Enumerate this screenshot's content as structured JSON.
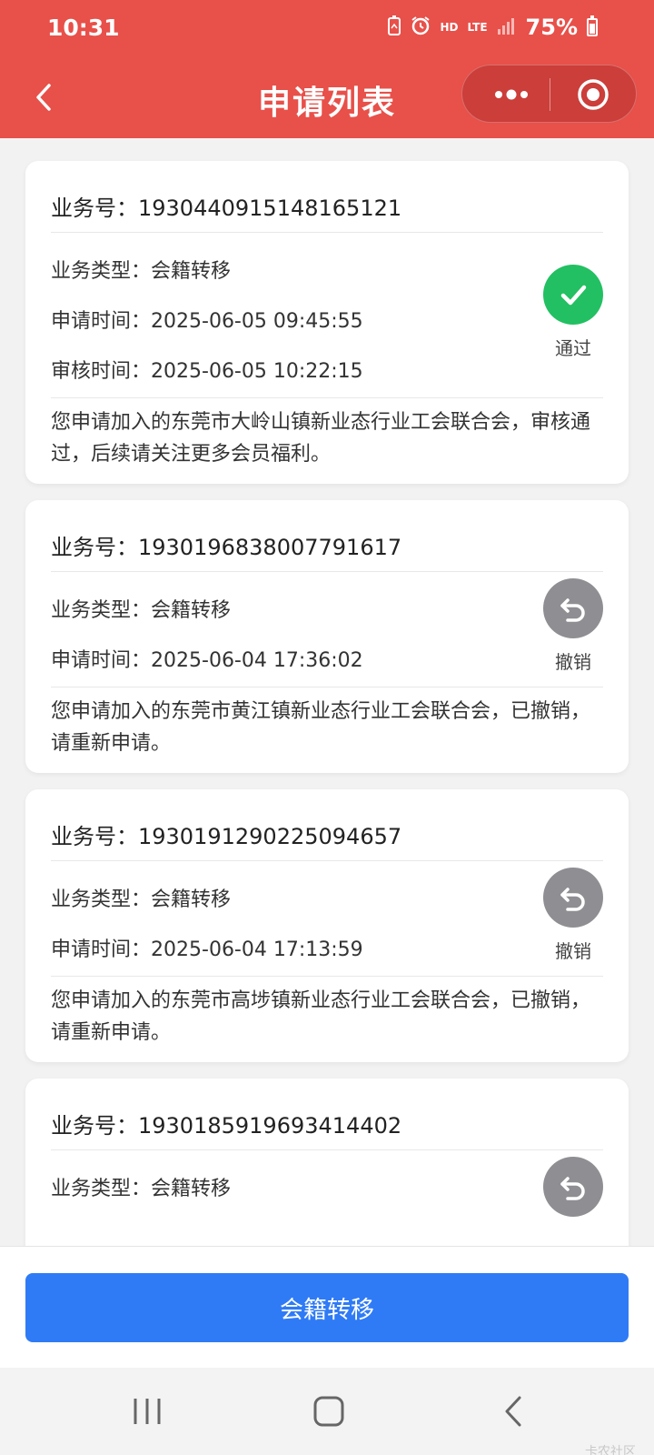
{
  "status_bar": {
    "time": "10:31",
    "network": "HD",
    "lte": "LTE",
    "battery": "75%"
  },
  "header": {
    "title": "申请列表"
  },
  "colors": {
    "header_bg": "#e8504a",
    "approved": "#22c062",
    "revoked": "#8e8e93",
    "primary": "#2f7bf6"
  },
  "applications": [
    {
      "no_label": "业务号：",
      "no": "1930440915148165121",
      "type_label": "业务类型：",
      "type": "会籍转移",
      "apply_label": "申请时间：",
      "apply_time": "2025-06-05 09:45:55",
      "review_label": "审核时间：",
      "review_time": "2025-06-05 10:22:15",
      "message": "您申请加入的东莞市大岭山镇新业态行业工会联合会，审核通过，后续请关注更多会员福利。",
      "status": "通过",
      "status_icon": "check-icon"
    },
    {
      "no_label": "业务号：",
      "no": "1930196838007791617",
      "type_label": "业务类型：",
      "type": "会籍转移",
      "apply_label": "申请时间：",
      "apply_time": "2025-06-04 17:36:02",
      "message": "您申请加入的东莞市黄江镇新业态行业工会联合会，已撤销，请重新申请。",
      "status": "撤销",
      "status_icon": "undo-icon"
    },
    {
      "no_label": "业务号：",
      "no": "1930191290225094657",
      "type_label": "业务类型：",
      "type": "会籍转移",
      "apply_label": "申请时间：",
      "apply_time": "2025-06-04 17:13:59",
      "message": "您申请加入的东莞市高埗镇新业态行业工会联合会，已撤销，请重新申请。",
      "status": "撤销",
      "status_icon": "undo-icon"
    },
    {
      "no_label": "业务号：",
      "no": "1930185919693414402",
      "type_label": "业务类型：",
      "type": "会籍转移",
      "status_icon": "undo-icon"
    }
  ],
  "bottom_button": "会籍转移",
  "watermark": "卡农社区"
}
